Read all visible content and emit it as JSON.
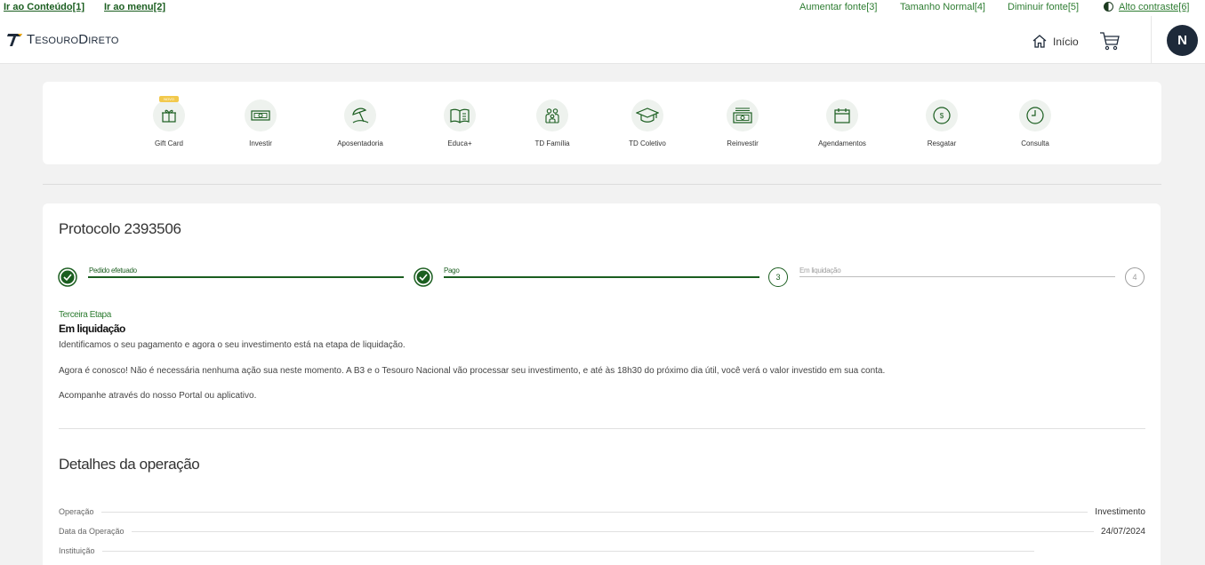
{
  "a11y": {
    "skip_content": "Ir ao Conteúdo[1]",
    "skip_menu": "Ir ao menu[2]",
    "font_increase": "Aumentar fonte[3]",
    "font_normal": "Tamanho Normal[4]",
    "font_decrease": "Diminuir fonte[5]",
    "high_contrast": "Alto contraste[6]"
  },
  "header": {
    "logo_text": "TesouroDireto",
    "home_label": "Início",
    "avatar_initial": "N"
  },
  "quick_menu": {
    "new_badge": "NOVO",
    "items": [
      {
        "label": "Gift Card",
        "icon": "gift-icon"
      },
      {
        "label": "Investir",
        "icon": "money-icon"
      },
      {
        "label": "Aposentadoria",
        "icon": "beach-umbrella-icon"
      },
      {
        "label": "Educa+",
        "icon": "open-book-icon"
      },
      {
        "label": "TD Família",
        "icon": "family-icon"
      },
      {
        "label": "TD Coletivo",
        "icon": "graduation-cap-icon"
      },
      {
        "label": "Reinvestir",
        "icon": "reinvest-icon"
      },
      {
        "label": "Agendamentos",
        "icon": "calendar-icon"
      },
      {
        "label": "Resgatar",
        "icon": "coin-icon"
      },
      {
        "label": "Consulta",
        "icon": "clock-icon"
      }
    ]
  },
  "protocol": {
    "title": "Protocolo 2393506",
    "steps": [
      {
        "label": "Pedido efetuado",
        "status": "done"
      },
      {
        "label": "Pago",
        "status": "done"
      },
      {
        "label": "Em liquidação",
        "status": "active",
        "number": "3"
      },
      {
        "label": "",
        "status": "pending",
        "number": "4"
      }
    ],
    "stage_kicker": "Terceira Etapa",
    "stage_title": "Em liquidação",
    "paragraphs": [
      "Identificamos o seu pagamento e agora o seu investimento está na etapa de liquidação.",
      "Agora é conosco! Não é necessária nenhuma ação sua neste momento. A B3 e o Tesouro Nacional vão processar seu investimento, e até às 18h30 do próximo dia útil, você verá o valor investido em sua conta.",
      "Acompanhe através do nosso Portal ou aplicativo."
    ]
  },
  "details": {
    "title": "Detalhes da operação",
    "rows": [
      {
        "key": "Operação",
        "value": "Investimento"
      },
      {
        "key": "Data da Operação",
        "value": "24/07/2024"
      },
      {
        "key": "Instituição",
        "value": ""
      }
    ]
  },
  "colors": {
    "brand_green": "#1b5e20",
    "link_green": "#2e7d32",
    "avatar_bg": "#1e2a3a",
    "badge_yellow": "#f2c94c"
  }
}
